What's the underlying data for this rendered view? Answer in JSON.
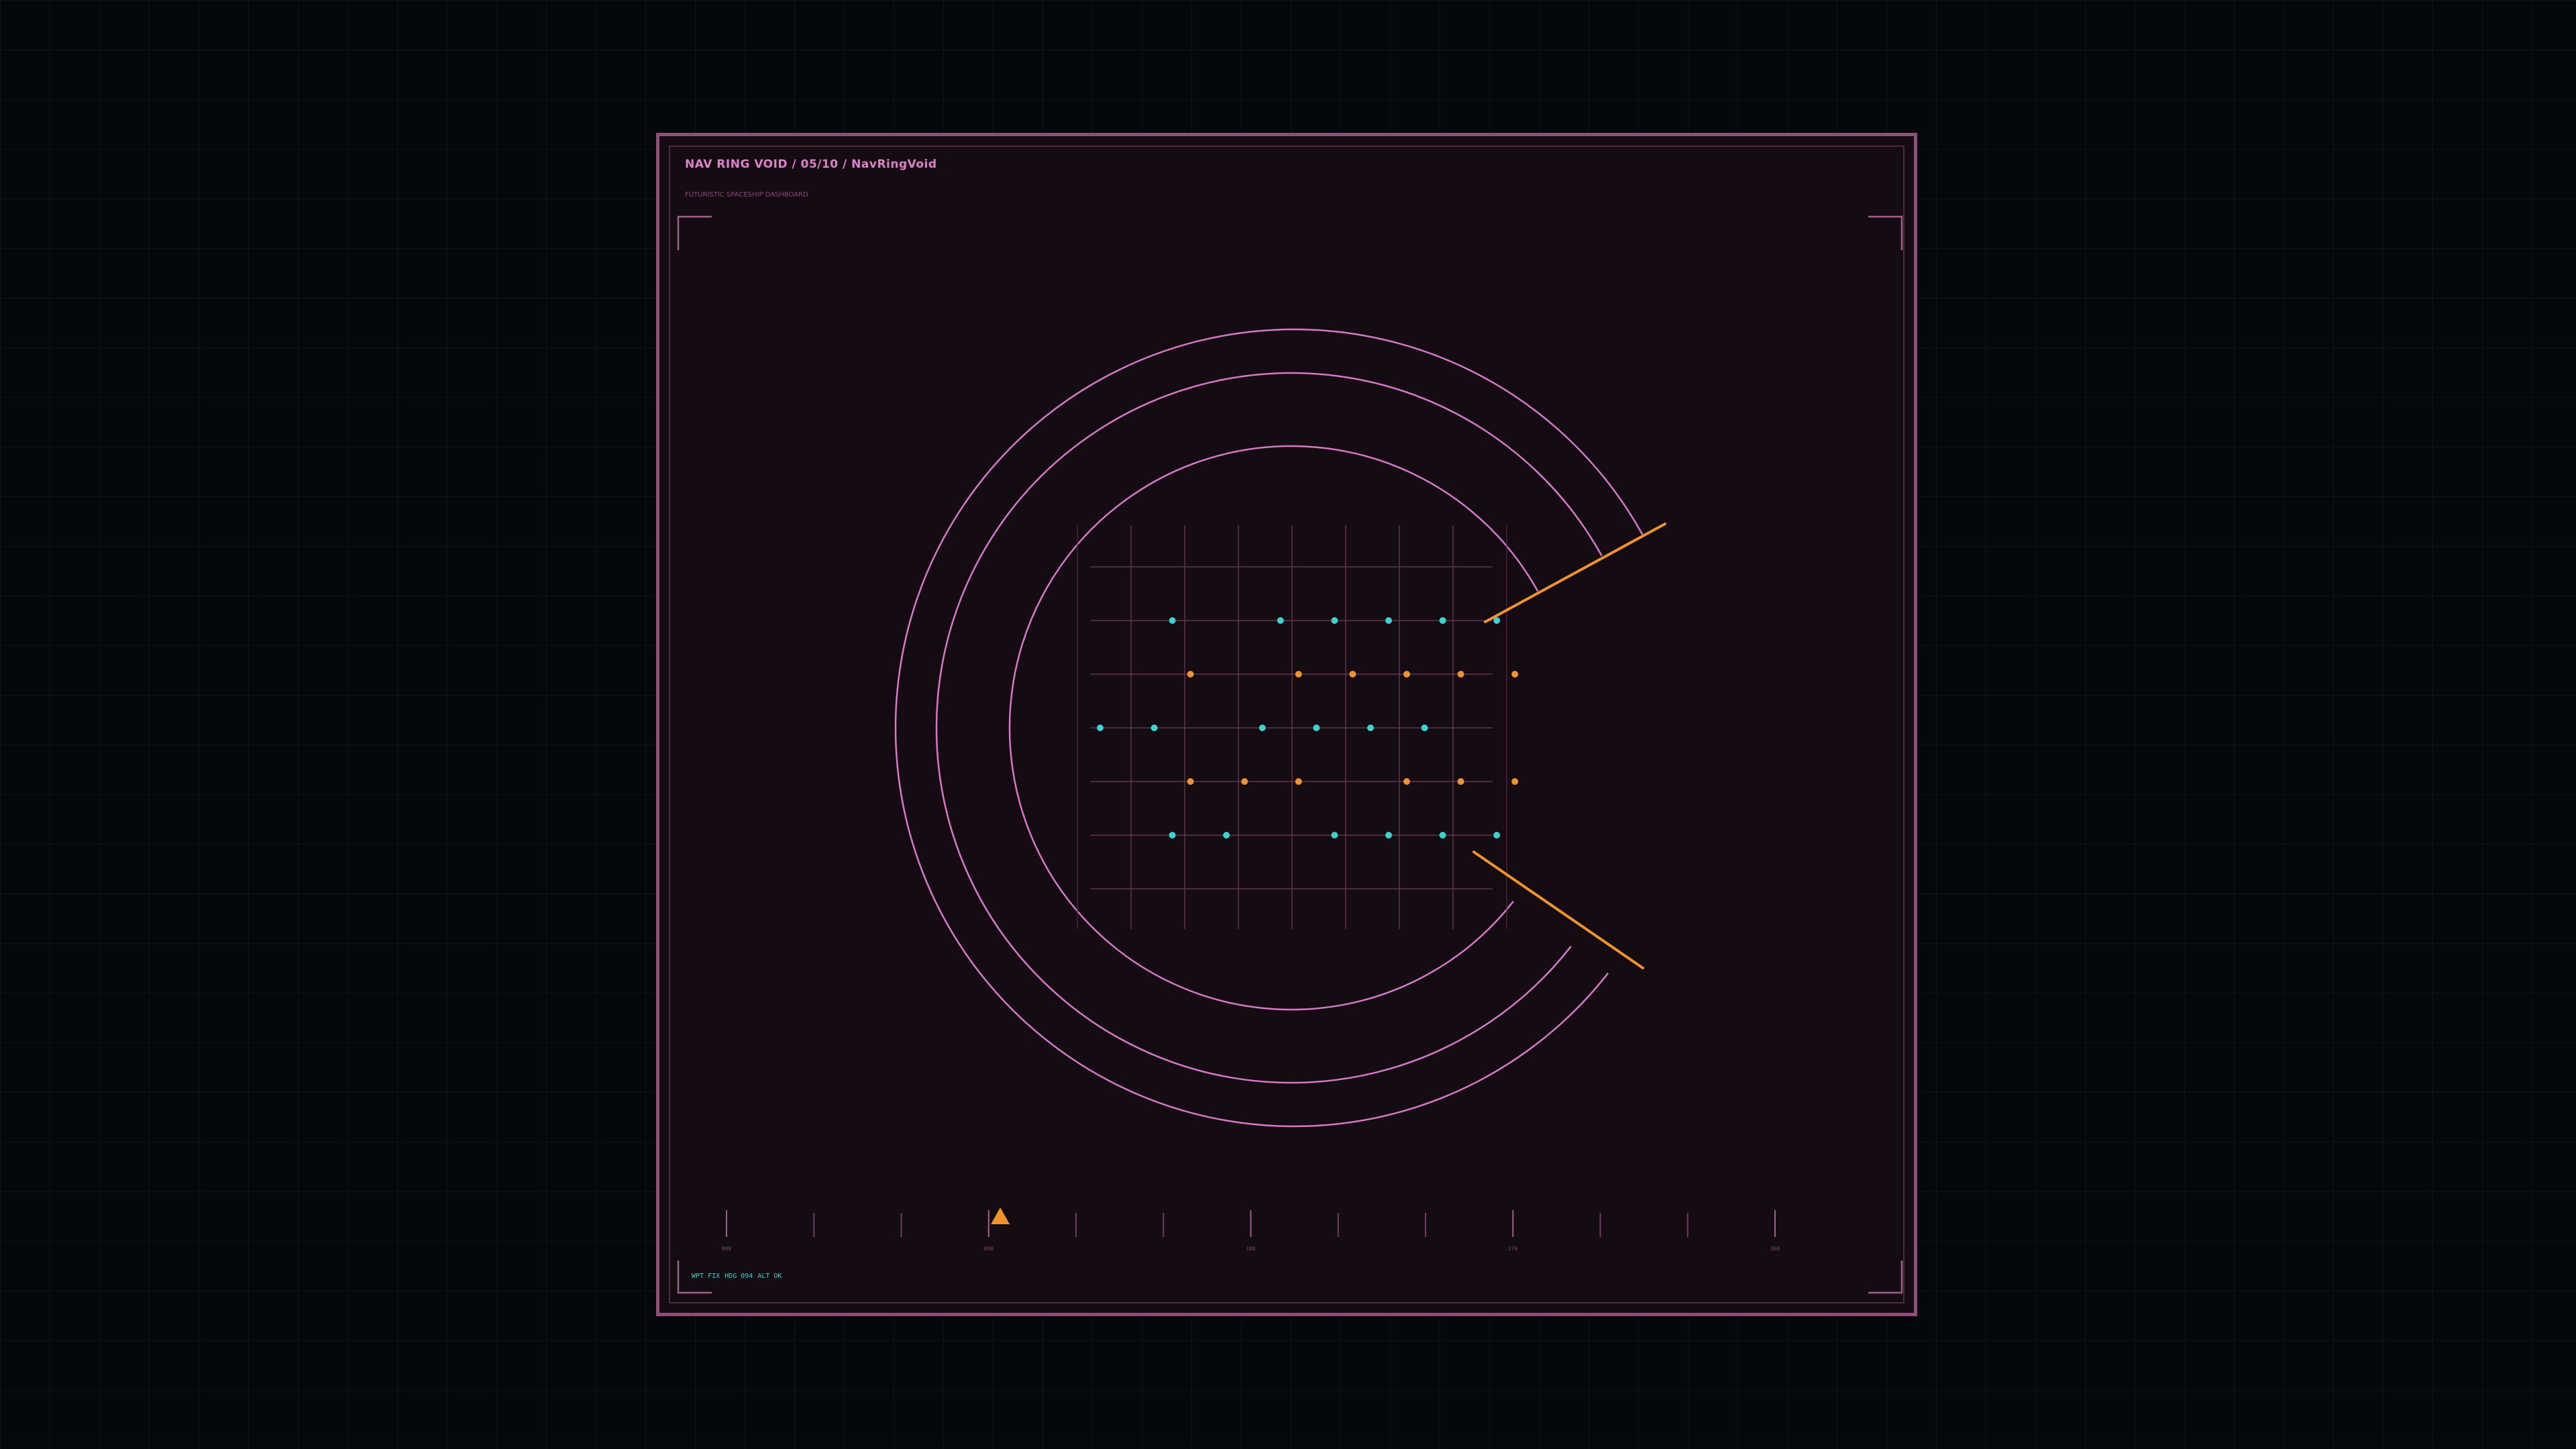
{
  "header": {
    "title": "NAV RING VOID  /  05/10  /  NavRingVoid",
    "subtitle": "FUTURISTIC SPACESHIP DASHBOARD"
  },
  "status": {
    "items": [
      "WPT FIX",
      "HDG 094",
      "ALT OK"
    ]
  },
  "heading_scale": {
    "tick_labels": [
      "000",
      "090",
      "180",
      "270",
      "360"
    ],
    "marker_value": 94,
    "range": [
      0,
      360
    ]
  },
  "nav_grid": {
    "rows": [
      {
        "color": "cyan",
        "points": [
          1,
          3,
          4,
          5,
          6,
          7
        ]
      },
      {
        "color": "orange",
        "points": [
          1,
          3,
          4,
          5,
          6,
          7
        ]
      },
      {
        "color": "cyan",
        "points": [
          0,
          1,
          3,
          4,
          5,
          6
        ]
      },
      {
        "color": "orange",
        "points": [
          1,
          2,
          3,
          5,
          6,
          7
        ]
      },
      {
        "color": "cyan",
        "points": [
          1,
          2,
          4,
          5,
          6,
          7
        ]
      }
    ]
  },
  "colors": {
    "background": "#04080b",
    "panel": "#150c13",
    "panel_border": "#8f4f79",
    "ring": "#d677c8",
    "accent_orange": "#f0922e",
    "accent_cyan": "#3fd0d0",
    "title": "#e07fcc"
  },
  "icons": {
    "heading_marker": "triangle-up-icon",
    "corner_bracket": "corner-bracket-icon"
  }
}
